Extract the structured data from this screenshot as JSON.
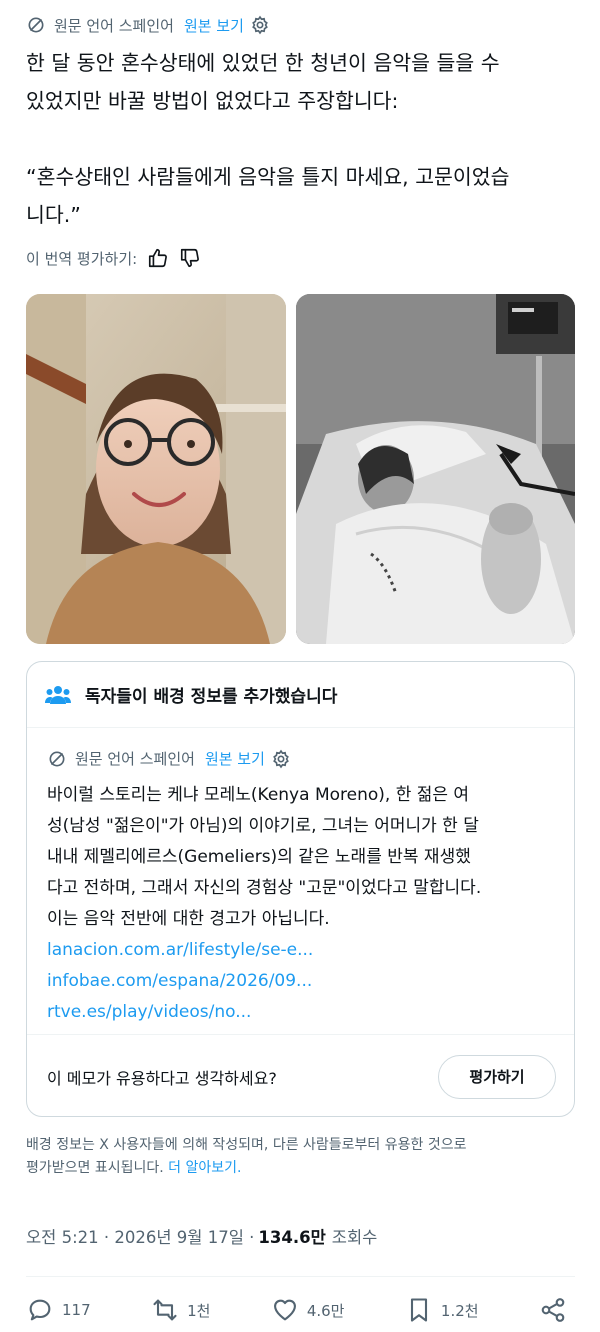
{
  "translation_bar": {
    "source_lang": "원문 언어 스페인어",
    "show_original": "원본 보기"
  },
  "tweet": {
    "lines": [
      "한 달 동안 혼수상태에 있었던 한 청년이 음악을 들을 수",
      "있었지만 바꿀 방법이 없었다고 주장합니다:",
      "“혼수상태인 사람들에게 음악을 틀지 마세요, 고문이었습",
      "니다.”"
    ]
  },
  "rate_translation": {
    "label": "이 번역 평가하기:"
  },
  "community_note": {
    "header": "독자들이 배경 정보를 추가했습니다",
    "source_lang": "원문 언어 스페인어",
    "show_original": "원본 보기",
    "body_lines": [
      "바이럴 스토리는 케냐 모레노(Kenya Moreno), 한 젊은 여",
      "성(남성 \"젊은이\"가 아님)의 이야기로, 그녀는 어머니가 한 달",
      "내내 제멜리에르스(Gemeliers)의 같은 노래를 반복 재생했",
      "다고 전하며, 그래서 자신의 경험상 \"고문\"이었다고 말합니다.",
      "이는 음악 전반에 대한 경고가 아닙니다."
    ],
    "links": [
      "lanacion.com.ar/lifestyle/se-e...",
      "infobae.com/espana/2026/09...",
      "rtve.es/play/videos/no..."
    ],
    "helpful_question": "이 메모가 유용하다고 생각하세요?",
    "rate_button": "평가하기"
  },
  "notes_info": {
    "line1": "배경 정보는 X 사용자들에 의해 작성되며, 다른 사람들로부터 유용한 것으로",
    "line2": "평가받으면 표시됩니다.",
    "learn_more": "더 알아보기."
  },
  "meta": {
    "time_date": "오전 5:21 · 2026년 9월 17일 ·",
    "views_count": "134.6만",
    "views_label": "조회수"
  },
  "actions": {
    "replies": "117",
    "reposts": "1천",
    "likes": "4.6만",
    "bookmarks": "1.2천"
  },
  "colors": {
    "accent": "#1d9bf0",
    "secondary_text": "#536471",
    "border": "#cfd9de"
  },
  "icons": [
    "translate-icon",
    "gear-icon",
    "thumbs-up-icon",
    "thumbs-down-icon",
    "people-icon",
    "reply-icon",
    "repost-icon",
    "like-icon",
    "bookmark-icon",
    "share-icon"
  ]
}
